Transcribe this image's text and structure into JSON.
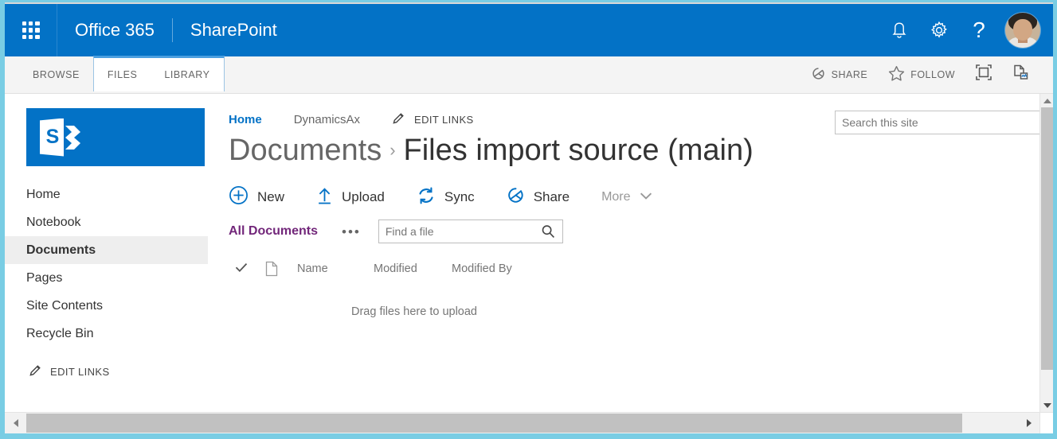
{
  "suitebar": {
    "app_launcher": "app-launcher",
    "office_label": "Office 365",
    "app_label": "SharePoint",
    "notifications_icon": "bell-icon",
    "settings_icon": "gear-icon",
    "help_label": "?",
    "avatar": "user-avatar",
    "bg_color": "#0372c6"
  },
  "ribbon": {
    "tabs": [
      {
        "label": "BROWSE",
        "active": false
      },
      {
        "label": "FILES",
        "active": true
      },
      {
        "label": "LIBRARY",
        "active": false
      }
    ],
    "actions": [
      {
        "label": "SHARE",
        "icon": "share-icon"
      },
      {
        "label": "FOLLOW",
        "icon": "star-icon"
      }
    ],
    "focus_icon": "focus-on-content-icon",
    "sync_page_icon": "page-sync-icon"
  },
  "sidebar": {
    "logo": {
      "name": "sharepoint-logo",
      "letter": "S"
    },
    "items": [
      {
        "label": "Home",
        "selected": false
      },
      {
        "label": "Notebook",
        "selected": false
      },
      {
        "label": "Documents",
        "selected": true
      },
      {
        "label": "Pages",
        "selected": false
      },
      {
        "label": "Site Contents",
        "selected": false
      },
      {
        "label": "Recycle Bin",
        "selected": false
      }
    ],
    "edit_links": {
      "label": "EDIT LINKS",
      "icon": "pencil-icon"
    }
  },
  "topnav": {
    "items": [
      {
        "label": "Home",
        "current": true
      },
      {
        "label": "DynamicsAx",
        "current": false
      }
    ],
    "edit_links": {
      "label": "EDIT LINKS",
      "icon": "pencil-icon"
    }
  },
  "site_search": {
    "placeholder": "Search this site",
    "value": ""
  },
  "page": {
    "title_parent": "Documents",
    "title_separator": "›",
    "title_current": "Files import source (main)"
  },
  "commands": [
    {
      "label": "New",
      "icon": "plus-circle-icon",
      "dim": false
    },
    {
      "label": "Upload",
      "icon": "upload-icon",
      "dim": false
    },
    {
      "label": "Sync",
      "icon": "sync-icon",
      "dim": false
    },
    {
      "label": "Share",
      "icon": "share-icon",
      "dim": false
    },
    {
      "label": "More",
      "icon": "chevron-down-icon",
      "dim": true
    }
  ],
  "viewbar": {
    "view_name": "All Documents",
    "ellipsis": "•••",
    "find_placeholder": "Find a file",
    "find_value": "",
    "search_icon": "magnifier-icon"
  },
  "list": {
    "select_all_icon": "checkmark-icon",
    "type_icon": "document-icon",
    "columns": [
      "Name",
      "Modified",
      "Modified By"
    ],
    "rows": [],
    "empty_message": "Drag files here to upload"
  },
  "scrollbars": {
    "vertical": {
      "up_icon": "triangle-up-icon",
      "down_icon": "triangle-down-icon"
    },
    "horizontal": {
      "left_icon": "triangle-left-icon",
      "right_icon": "triangle-right-icon"
    }
  },
  "colors": {
    "brand_blue": "#0372c6",
    "view_purple": "#72277a",
    "frame_blue": "#79cde4",
    "selected_nav_bg": "#eeeeee"
  }
}
